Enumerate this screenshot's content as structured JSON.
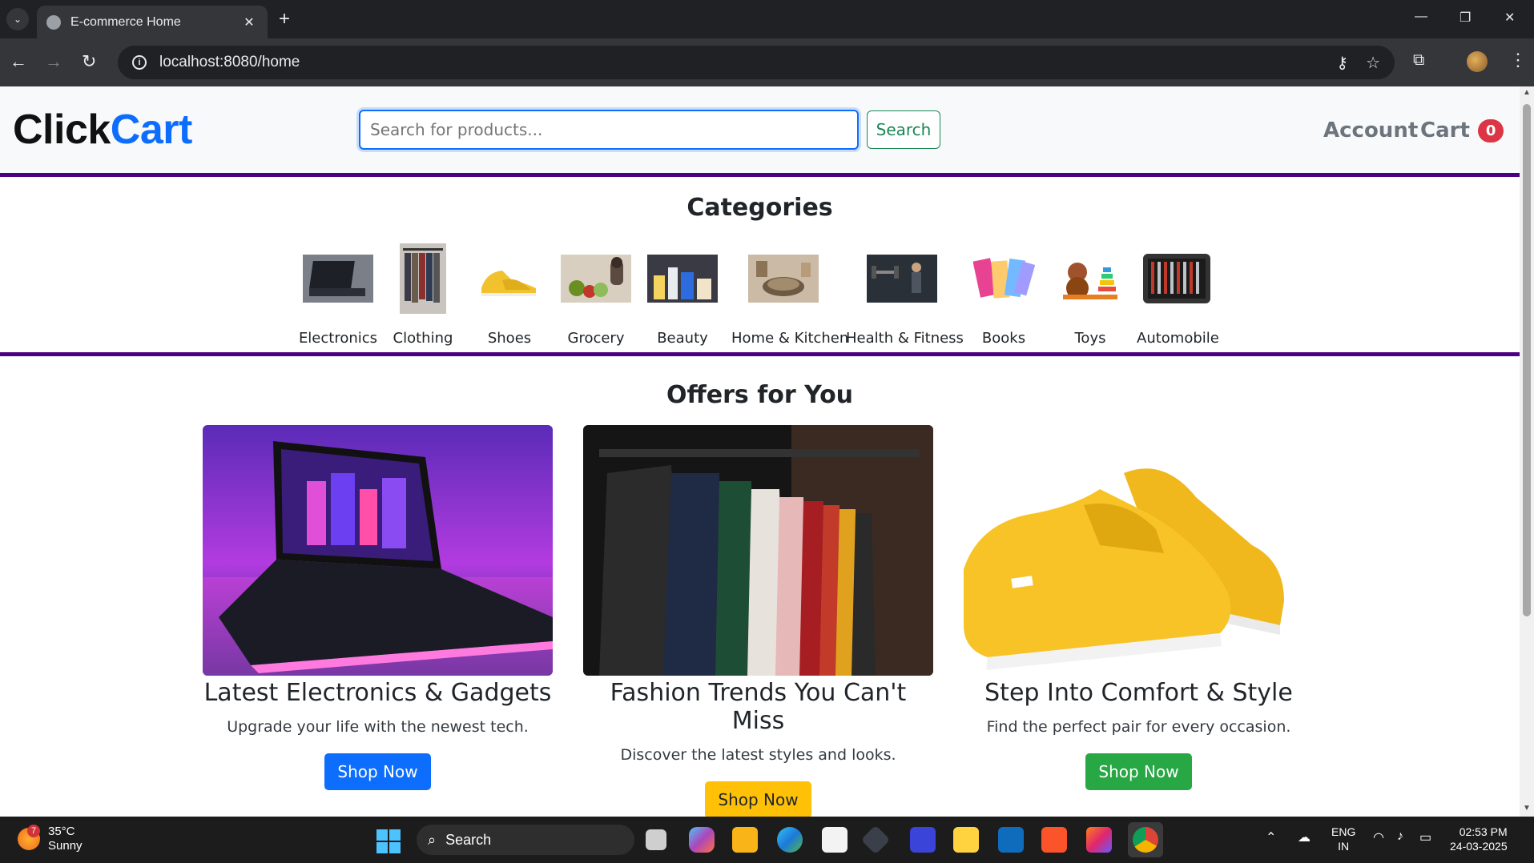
{
  "browser": {
    "tab_title": "E-commerce Home",
    "url": "localhost:8080/home"
  },
  "header": {
    "logo_part1": "Click",
    "logo_part2": "Cart",
    "search_placeholder": "Search for products...",
    "search_button": "Search",
    "account_label": "Account",
    "cart_label": "Cart",
    "cart_count": "0"
  },
  "categories": {
    "title": "Categories",
    "items": [
      {
        "label": "Electronics",
        "icon": "laptop-icon"
      },
      {
        "label": "Clothing",
        "icon": "clothing-rack-icon"
      },
      {
        "label": "Shoes",
        "icon": "shoe-icon"
      },
      {
        "label": "Grocery",
        "icon": "grocery-icon"
      },
      {
        "label": "Beauty",
        "icon": "beauty-products-icon"
      },
      {
        "label": "Home & Kitchen",
        "icon": "kitchen-icon"
      },
      {
        "label": "Health & Fitness",
        "icon": "fitness-icon"
      },
      {
        "label": "Books",
        "icon": "books-icon"
      },
      {
        "label": "Toys",
        "icon": "toys-icon"
      },
      {
        "label": "Automobile",
        "icon": "toolkit-icon"
      }
    ]
  },
  "offers": {
    "title": "Offers for You",
    "items": [
      {
        "title": "Latest Electronics & Gadgets",
        "text": "Upgrade your life with the newest tech.",
        "button": "Shop Now",
        "button_color": "#0d6efd",
        "button_text_color": "#ffffff"
      },
      {
        "title": "Fashion Trends You Can't Miss",
        "text": "Discover the latest styles and looks.",
        "button": "Shop Now",
        "button_color": "#ffc107",
        "button_text_color": "#212529"
      },
      {
        "title": "Step Into Comfort & Style",
        "text": "Find the perfect pair for every occasion.",
        "button": "Shop Now",
        "button_color": "#28a745",
        "button_text_color": "#ffffff"
      }
    ]
  },
  "taskbar": {
    "weather_temp": "35°C",
    "weather_desc": "Sunny",
    "weather_badge": "7",
    "search_label": "Search",
    "lang_line1": "ENG",
    "lang_line2": "IN",
    "time": "02:53 PM",
    "date": "24-03-2025"
  },
  "colors": {
    "brand_accent": "#0d6efd",
    "divider": "#4b0082",
    "cart_badge": "#dc3545"
  }
}
